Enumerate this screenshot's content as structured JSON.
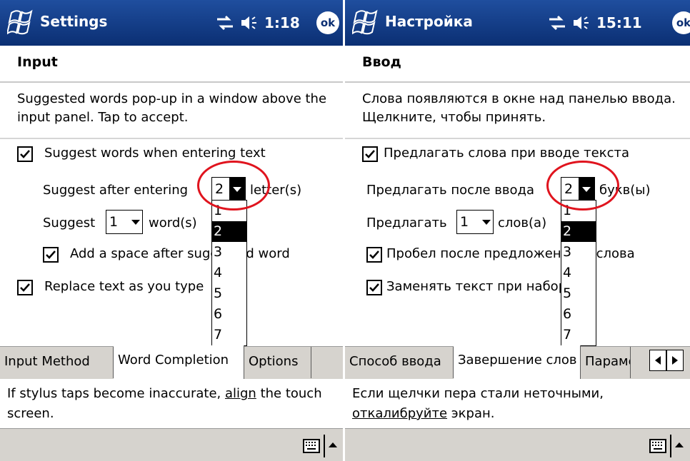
{
  "screens": [
    {
      "title": "Settings",
      "clock": "1:18",
      "ok_label": "ok",
      "header": "Input",
      "description": "Suggested words pop-up in a window above the input panel.  Tap to accept.",
      "suggest_words_label": "Suggest words when entering text",
      "suggest_words_checked": true,
      "suggest_after_label": "Suggest after entering",
      "letters_value": "2",
      "letters_suffix": "letter(s)",
      "suggest_label": "Suggest",
      "words_value": "1",
      "words_suffix": "word(s)",
      "add_space_label": "Add a space after suggested word",
      "add_space_checked": true,
      "replace_text_label": "Replace text as you type",
      "replace_text_checked": true,
      "dropdown_options": [
        "1",
        "2",
        "3",
        "4",
        "5",
        "6",
        "7"
      ],
      "dropdown_selected": "2",
      "tabs": [
        "Input Method",
        "Word Completion",
        "Options"
      ],
      "active_tab": "Word Completion",
      "footer_before": "If stylus taps become inaccurate, ",
      "footer_link": "align",
      "footer_after": " the touch screen."
    },
    {
      "title": "Настройка",
      "clock": "15:11",
      "ok_label": "ok",
      "header": "Ввод",
      "description": "Слова появляются в окне над панелью ввода. Щелкните, чтобы принять.",
      "suggest_words_label": "Предлагать слова при вводе текста",
      "suggest_words_checked": true,
      "suggest_after_label": "Предлагать после ввода",
      "letters_value": "2",
      "letters_suffix": "букв(ы)",
      "suggest_label": "Предлагать",
      "words_value": "1",
      "words_suffix": "слов(а)",
      "add_space_label": "Пробел после предложенного слова",
      "add_space_checked": true,
      "replace_text_label": "Заменять текст при наборе",
      "replace_text_checked": true,
      "dropdown_options": [
        "1",
        "2",
        "3",
        "4",
        "5",
        "6",
        "7"
      ],
      "dropdown_selected": "2",
      "tabs": [
        "Способ ввода",
        "Завершение слов",
        "Параметры"
      ],
      "active_tab": "Завершение слов",
      "footer_before": "Если щелчки пера стали неточными, ",
      "footer_link": "откалибруйте",
      "footer_after": " экран."
    }
  ],
  "colors": {
    "titlebar": "#0b2f73",
    "highlight_ring": "#e0141e",
    "tab_background": "#d6d3ce",
    "selection": "#000000"
  },
  "icons": [
    "windows-flag-icon",
    "connectivity-icon",
    "volume-icon",
    "keyboard-icon",
    "sip-arrow-up-icon"
  ]
}
